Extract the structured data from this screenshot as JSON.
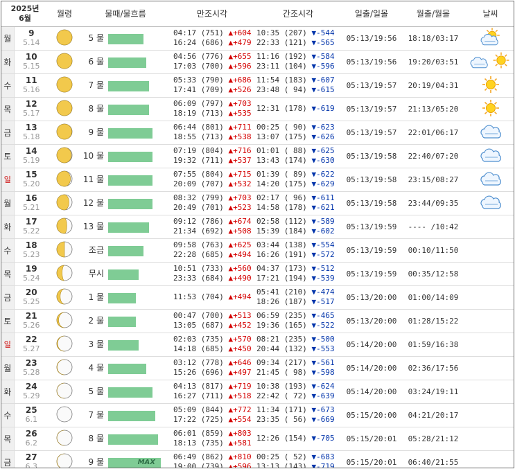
{
  "header": {
    "year_month": [
      "2025년",
      "6월"
    ],
    "moon_phase": "월령",
    "tide": "물때/물흐름",
    "high": "만조시각",
    "low": "간조시각",
    "sun": "일출/일몰",
    "moon": "월출/월몰",
    "weather": "날씨"
  },
  "colors": {
    "bar": "#7fcc95",
    "up": "#d40000",
    "down": "#0033aa",
    "sunday": "#c00000",
    "moon": "#f2c94c"
  },
  "rows": [
    {
      "dow": "월",
      "day": "9",
      "lunar": "5.14",
      "tide": "5 물",
      "level": 0.67,
      "high": [
        "04:17 (751) ",
        "+604",
        "16:24 (686) ",
        "+479"
      ],
      "low": [
        "10:35 (207) ",
        "-544",
        "22:33 (121) ",
        "-565"
      ],
      "sun": "05:13/19:56",
      "moon": "18:18/03:17",
      "wx": "partly-cloudy",
      "illum": 0.98
    },
    {
      "dow": "화",
      "day": "10",
      "lunar": "5.15",
      "tide": "6 물",
      "level": 0.72,
      "high": [
        "04:56 (776) ",
        "+655",
        "17:03 (700) ",
        "+596"
      ],
      "low": [
        "11:16 (192) ",
        "-584",
        "23:11 (104) ",
        "-596"
      ],
      "sun": "05:13/19:56",
      "moon": "19:20/03:51",
      "wx": "sun-and-cloud",
      "illum": 1.0
    },
    {
      "dow": "수",
      "day": "11",
      "lunar": "5.16",
      "tide": "7 물",
      "level": 0.78,
      "high": [
        "05:33 (790) ",
        "+686",
        "17:41 (709) ",
        "+526"
      ],
      "low": [
        "11:54 (183) ",
        "-607",
        "23:48 ( 94) ",
        "-615"
      ],
      "sun": "05:13/19:57",
      "moon": "20:19/04:31",
      "wx": "sunny",
      "illum": 0.99
    },
    {
      "dow": "목",
      "day": "12",
      "lunar": "5.17",
      "tide": "8 물",
      "level": 0.78,
      "high": [
        "06:09 (797) ",
        "+703",
        "18:19 (713) ",
        "+535"
      ],
      "low": [
        "12:31 (178) ",
        "-619",
        "",
        ""
      ],
      "sun": "05:13/19:57",
      "moon": "21:13/05:20",
      "wx": "sunny",
      "illum": 0.96
    },
    {
      "dow": "금",
      "day": "13",
      "lunar": "5.18",
      "tide": "9 물",
      "level": 0.84,
      "high": [
        "06:44 (801) ",
        "+711",
        "18:55 (713) ",
        "+538"
      ],
      "low": [
        "00:25 ( 90) ",
        "-623",
        "13:07 (175) ",
        "-626"
      ],
      "sun": "05:13/19:57",
      "moon": "22:01/06:17",
      "wx": "cloudy",
      "illum": 0.92
    },
    {
      "dow": "토",
      "day": "14",
      "lunar": "5.19",
      "tide": "10 물",
      "level": 0.84,
      "high": [
        "07:19 (804) ",
        "+716",
        "19:32 (711) ",
        "+537"
      ],
      "low": [
        "01:01 ( 88) ",
        "-625",
        "13:43 (174) ",
        "-630"
      ],
      "sun": "05:13/19:58",
      "moon": "22:40/07:20",
      "wx": "cloudy",
      "illum": 0.86
    },
    {
      "dow": "일",
      "day": "15",
      "lunar": "5.20",
      "tide": "11 물",
      "level": 0.84,
      "high": [
        "07:55 (804) ",
        "+715",
        "20:09 (707) ",
        "+532"
      ],
      "low": [
        "01:39 ( 89) ",
        "-622",
        "14:20 (175) ",
        "-629"
      ],
      "sun": "05:13/19:58",
      "moon": "23:15/08:27",
      "wx": "cloudy",
      "illum": 0.79
    },
    {
      "dow": "월",
      "day": "16",
      "lunar": "5.21",
      "tide": "12 물",
      "level": 0.84,
      "high": [
        "08:32 (799) ",
        "+703",
        "20:49 (701) ",
        "+523"
      ],
      "low": [
        "02:17 ( 96) ",
        "-611",
        "14:58 (178) ",
        "-621"
      ],
      "sun": "05:13/19:58",
      "moon": "23:44/09:35",
      "wx": "cloudy",
      "illum": 0.7
    },
    {
      "dow": "화",
      "day": "17",
      "lunar": "5.22",
      "tide": "13 물",
      "level": 0.78,
      "high": [
        "09:12 (786) ",
        "+674",
        "21:34 (692) ",
        "+508"
      ],
      "low": [
        "02:58 (112) ",
        "-589",
        "15:39 (184) ",
        "-602"
      ],
      "sun": "05:13/19:59",
      "moon": "---- /10:42",
      "wx": "",
      "illum": 0.6
    },
    {
      "dow": "수",
      "day": "18",
      "lunar": "5.23",
      "tide": "조금",
      "level": 0.67,
      "high": [
        "09:58 (763) ",
        "+625",
        "22:28 (685) ",
        "+494"
      ],
      "low": [
        "03:44 (138) ",
        "-554",
        "16:26 (191) ",
        "-572"
      ],
      "sun": "05:13/19:59",
      "moon": "00:10/11:50",
      "wx": "",
      "illum": 0.5
    },
    {
      "dow": "목",
      "day": "19",
      "lunar": "5.24",
      "tide": "무시",
      "level": 0.58,
      "high": [
        "10:51 (733) ",
        "+560",
        "23:33 (684) ",
        "+490"
      ],
      "low": [
        "04:37 (173) ",
        "-512",
        "17:21 (194) ",
        "-539"
      ],
      "sun": "05:13/19:59",
      "moon": "00:35/12:58",
      "wx": "",
      "illum": 0.4
    },
    {
      "dow": "금",
      "day": "20",
      "lunar": "5.25",
      "tide": "1 물",
      "level": 0.52,
      "high": [
        "11:53 (704) ",
        "+494",
        "",
        ""
      ],
      "low": [
        "05:41 (210) ",
        "-474",
        "18:26 (187) ",
        "-517"
      ],
      "sun": "05:13/20:00",
      "moon": "01:00/14:09",
      "wx": "",
      "illum": 0.31
    },
    {
      "dow": "토",
      "day": "21",
      "lunar": "5.26",
      "tide": "2 물",
      "level": 0.52,
      "high": [
        "00:47 (700) ",
        "+513",
        "13:05 (687) ",
        "+452"
      ],
      "low": [
        "06:59 (235) ",
        "-465",
        "19:36 (165) ",
        "-522"
      ],
      "sun": "05:13/20:00",
      "moon": "01:28/15:22",
      "wx": "",
      "illum": 0.22
    },
    {
      "dow": "일",
      "day": "22",
      "lunar": "5.27",
      "tide": "3 물",
      "level": 0.58,
      "high": [
        "02:03 (735) ",
        "+570",
        "14:18 (685) ",
        "+450"
      ],
      "low": [
        "08:21 (235) ",
        "-500",
        "20:44 (132) ",
        "-553"
      ],
      "sun": "05:14/20:00",
      "moon": "01:59/16:38",
      "wx": "",
      "illum": 0.14
    },
    {
      "dow": "월",
      "day": "23",
      "lunar": "5.28",
      "tide": "4 물",
      "level": 0.72,
      "high": [
        "03:12 (778) ",
        "+646",
        "15:26 (696) ",
        "+497"
      ],
      "low": [
        "09:34 (217) ",
        "-561",
        "21:45 ( 98) ",
        "-598"
      ],
      "sun": "05:14/20:00",
      "moon": "02:36/17:56",
      "wx": "",
      "illum": 0.08
    },
    {
      "dow": "화",
      "day": "24",
      "lunar": "5.29",
      "tide": "5 물",
      "level": 0.84,
      "high": [
        "04:13 (817) ",
        "+719",
        "16:27 (711) ",
        "+518"
      ],
      "low": [
        "10:38 (193) ",
        "-624",
        "22:42 ( 72) ",
        "-639"
      ],
      "sun": "05:14/20:00",
      "moon": "03:24/19:11",
      "wx": "",
      "illum": 0.03
    },
    {
      "dow": "수",
      "day": "25",
      "lunar": "6.1",
      "tide": "7 물",
      "level": 0.9,
      "high": [
        "05:09 (844) ",
        "+772",
        "17:22 (725) ",
        "+554"
      ],
      "low": [
        "11:34 (171) ",
        "-673",
        "23:35 ( 56) ",
        "-669"
      ],
      "sun": "05:15/20:00",
      "moon": "04:21/20:17",
      "wx": "",
      "illum": 0.0
    },
    {
      "dow": "목",
      "day": "26",
      "lunar": "6.2",
      "tide": "8 물",
      "level": 0.95,
      "high": [
        "06:01 (859) ",
        "+803",
        "18:13 (735) ",
        "+581"
      ],
      "low": [
        "12:26 (154) ",
        "-705",
        "",
        ""
      ],
      "sun": "05:15/20:01",
      "moon": "05:28/21:12",
      "wx": "",
      "illum": 0.02
    },
    {
      "dow": "금",
      "day": "27",
      "lunar": "6.3",
      "tide": "9 물",
      "level": 1.0,
      "max": "MAX",
      "high": [
        "06:49 (862) ",
        "+810",
        "19:00 (739) ",
        "+596"
      ],
      "low": [
        "00:25 ( 52) ",
        "-683",
        "13:13 (143) ",
        "-719"
      ],
      "sun": "05:15/20:01",
      "moon": "06:40/21:55",
      "wx": "",
      "illum": 0.06
    }
  ]
}
